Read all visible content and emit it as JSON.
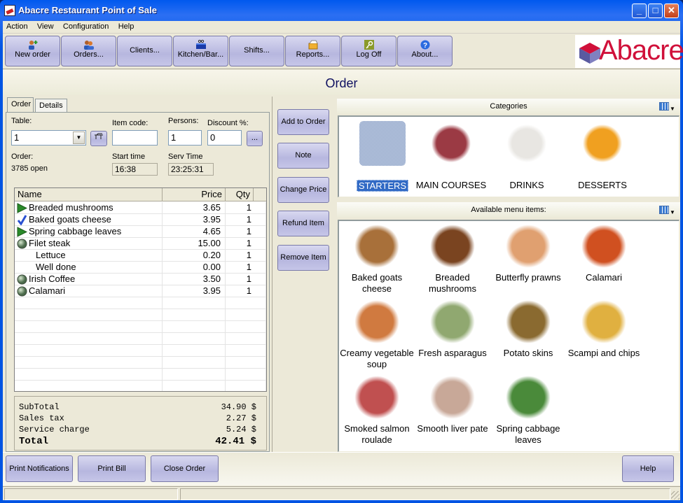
{
  "window": {
    "title": "Abacre Restaurant Point of Sale",
    "controls": {
      "minimize": "_",
      "maximize": "□",
      "close": "✕"
    }
  },
  "menubar": [
    "Action",
    "View",
    "Configuration",
    "Help"
  ],
  "toolbar": [
    {
      "label": "New order",
      "icon": "new-order-icon"
    },
    {
      "label": "Orders...",
      "icon": "orders-icon"
    },
    {
      "label": "Clients...",
      "icon": null
    },
    {
      "label": "Kitchen/Bar...",
      "icon": "kitchen-icon"
    },
    {
      "label": "Shifts...",
      "icon": null
    },
    {
      "label": "Reports...",
      "icon": "reports-icon"
    },
    {
      "label": "Log Off",
      "icon": "key-icon"
    },
    {
      "label": "About...",
      "icon": "help-icon"
    }
  ],
  "logo": {
    "text": "Abacre"
  },
  "heading": "Order",
  "tabs": [
    "Order",
    "Details"
  ],
  "form": {
    "table_label": "Table:",
    "table_value": "1",
    "item_code_label": "Item code:",
    "item_code_value": "",
    "persons_label": "Persons:",
    "persons_value": "1",
    "discount_label": "Discount %:",
    "discount_value": "0",
    "discount_button": "...",
    "order_label": "Order:",
    "order_value": "3785 open",
    "start_time_label": "Start time",
    "start_time_value": "16:38",
    "serv_time_label": "Serv Time",
    "serv_time_value": "23:25:31"
  },
  "order_grid": {
    "columns": [
      "Name",
      "Price",
      "Qty"
    ],
    "rows": [
      {
        "name": "Breaded mushrooms",
        "price": "3.65",
        "qty": "1",
        "status": "sent",
        "indent": false
      },
      {
        "name": "Baked goats cheese",
        "price": "3.95",
        "qty": "1",
        "status": "served",
        "indent": false
      },
      {
        "name": "Spring cabbage leaves",
        "price": "4.65",
        "qty": "1",
        "status": "sent",
        "indent": false
      },
      {
        "name": "Filet steak",
        "price": "15.00",
        "qty": "1",
        "status": "new",
        "indent": false
      },
      {
        "name": "Lettuce",
        "price": "0.20",
        "qty": "1",
        "status": "",
        "indent": true
      },
      {
        "name": "Well done",
        "price": "0.00",
        "qty": "1",
        "status": "",
        "indent": true
      },
      {
        "name": "Irish Coffee",
        "price": "3.50",
        "qty": "1",
        "status": "new",
        "indent": false
      },
      {
        "name": "Calamari",
        "price": "3.95",
        "qty": "1",
        "status": "new",
        "indent": false
      }
    ]
  },
  "totals": {
    "subtotal_label": "SubTotal",
    "subtotal_value": "34.90 $",
    "tax_label": "Sales tax",
    "tax_value": "2.27 $",
    "service_label": "Service charge",
    "service_value": "5.24 $",
    "total_label": "Total",
    "total_value": "42.41 $"
  },
  "actions": [
    "Add to Order",
    "Note",
    "Change Price",
    "Refund Item",
    "Remove Item"
  ],
  "categories": {
    "title": "Categories",
    "items": [
      {
        "label": "STARTERS",
        "selected": true,
        "color": "#8a9fc0"
      },
      {
        "label": "MAIN COURSES",
        "selected": false,
        "color": "#9b3a44"
      },
      {
        "label": "DRINKS",
        "selected": false,
        "color": "#e8e6e2"
      },
      {
        "label": "DESSERTS",
        "selected": false,
        "color": "#f0a020"
      }
    ]
  },
  "menu_items": {
    "title": "Available menu items:",
    "items": [
      {
        "label": "Baked goats cheese",
        "color": "#a8703a"
      },
      {
        "label": "Breaded mushrooms",
        "color": "#7a4420"
      },
      {
        "label": "Butterfly prawns",
        "color": "#e0a070"
      },
      {
        "label": "Calamari",
        "color": "#d05020"
      },
      {
        "label": "Creamy vegetable soup",
        "color": "#d07a40"
      },
      {
        "label": "Fresh asparagus",
        "color": "#90a870"
      },
      {
        "label": "Potato skins",
        "color": "#8a6a30"
      },
      {
        "label": "Scampi and chips",
        "color": "#e0b040"
      },
      {
        "label": "Smoked salmon roulade",
        "color": "#c05050"
      },
      {
        "label": "Smooth liver pate",
        "color": "#c8a898"
      },
      {
        "label": "Spring cabbage leaves",
        "color": "#4a8a3a"
      }
    ]
  },
  "bottom": {
    "print_notifications": "Print Notifications",
    "print_bill": "Print Bill",
    "close_order": "Close Order",
    "help": "Help"
  }
}
